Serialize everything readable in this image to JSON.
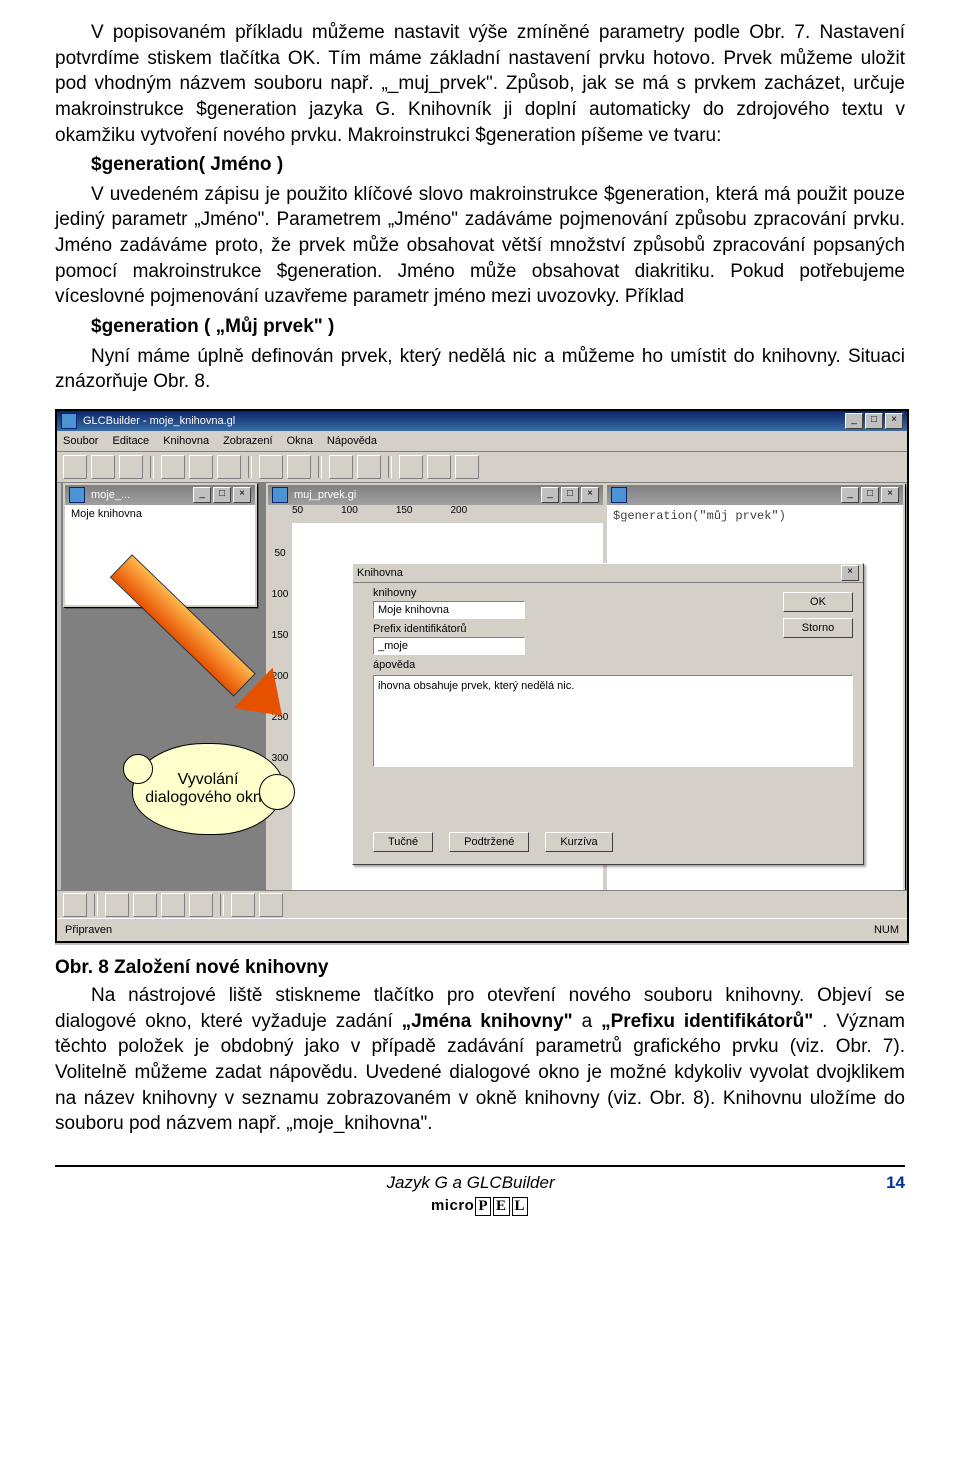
{
  "para1": "V popisovaném příkladu můžeme nastavit výše zmíněné parametry podle Obr. 7. Nastavení potvrdíme stiskem tlačítka OK. Tím máme základní nastavení prvku hotovo. Prvek můžeme uložit pod vhodným názvem souboru např. „_muj_prvek\". Způsob, jak se má s prvkem zacházet, určuje makroinstrukce $generation jazyka G. Knihovník ji doplní automaticky do zdrojového textu v okamžiku vytvoření nového prvku. Makroinstrukci $generation píšeme ve tvaru:",
  "code1": "$generation( Jméno )",
  "para2": "V uvedeném zápisu je použito klíčové slovo makroinstrukce $generation, která má použit pouze jediný parametr „Jméno\". Parametrem „Jméno\" zadáváme pojmenování způsobu zpracování prvku. Jméno zadáváme proto, že prvek může obsahovat větší množství způsobů zpracování popsaných pomocí makroinstrukce $generation. Jméno může obsahovat diakritiku. Pokud potřebujeme víceslovné pojmenování uzavřeme parametr jméno mezi uvozovky. Příklad",
  "code2": "$generation ( „Můj prvek\" )",
  "para3": "Nyní máme úplně definován prvek, který nedělá nic a můžeme ho umístit do knihovny. Situaci znázorňuje Obr. 8.",
  "caption": "Obr. 8 Založení nové knihovny",
  "para4a": "Na nástrojové liště stiskneme tlačítko pro otevření nového souboru knihovny. Objeví se dialogové okno, které vyžaduje zadání ",
  "para4b": "„Jména knihovny\"",
  "para4c": "  a  ",
  "para4d": "„Prefixu identifikátorů\"",
  "para4e": " . Význam těchto položek je obdobný jako v případě zadávání parametrů grafického prvku (viz. Obr. 7). Volitelně můžeme zadat nápovědu. Uvedené dialogové okno je možné kdykoliv vyvolat dvojklikem na název knihovny v seznamu zobrazovaném v okně knihovny (viz. Obr. 8). Knihovnu uložíme do souboru pod názvem např. „moje_knihovna\".",
  "app": {
    "title": "GLCBuilder - moje_knihovna.gl",
    "menus": [
      "Soubor",
      "Editace",
      "Knihovna",
      "Zobrazení",
      "Okna",
      "Nápověda"
    ],
    "status_left": "Připraven",
    "status_right": "NUM"
  },
  "winLib": {
    "title": "moje_...",
    "item": "Moje knihovna"
  },
  "winPrvek": {
    "title": "muj_prvek.gi",
    "rulerH": [
      "50",
      "100",
      "150",
      "200"
    ],
    "rulerV": [
      "50",
      "100",
      "150",
      "200",
      "250",
      "300"
    ]
  },
  "winCode": {
    "text": "$generation(\"můj prvek\")"
  },
  "dialog": {
    "title": "Knihovna",
    "lbl1": "knihovny",
    "val1": "Moje knihovna",
    "lbl2": "Prefix identifikátorů",
    "val2": "_moje",
    "lbl3": "ápověda",
    "help": "ihovna obsahuje prvek, který nedělá nic.",
    "ok": "OK",
    "cancel": "Storno",
    "bold": "Tučné",
    "under": "Podtržené",
    "italic": "Kurzíva"
  },
  "cloud": "Vyvolání dialogového okna",
  "footer": {
    "title": "Jazyk G a GLCBuilder",
    "page": "14",
    "logo_pre": "micro"
  }
}
